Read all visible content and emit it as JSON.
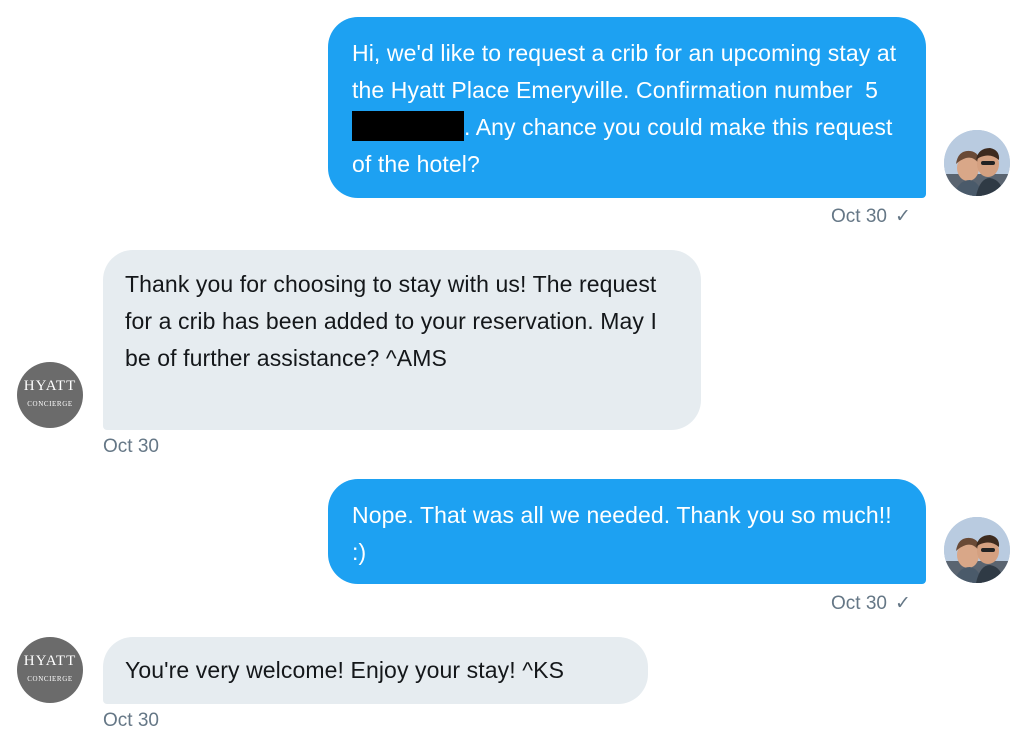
{
  "conversation": {
    "messages": [
      {
        "sender": "user",
        "text_before_redaction": "Hi, we'd like to request a crib for an upcoming stay at the Hyatt Place Emeryville. Confirmation number",
        "redaction_char": "5",
        "text_after_redaction": ". Any chance you could make this request of the hotel?",
        "time": "Oct 30",
        "read_icon": "check-icon"
      },
      {
        "sender": "hyatt",
        "text": "Thank you for choosing to stay with us! The request for a crib has been added to your reservation. May I be of further assistance? ^AMS",
        "time": "Oct 30"
      },
      {
        "sender": "user",
        "text": "Nope. That was all we needed. Thank you so much!! :)",
        "time": "Oct 30",
        "read_icon": "check-icon"
      },
      {
        "sender": "hyatt",
        "text": "You're very welcome! Enjoy your stay! ^KS",
        "time": "Oct 30"
      }
    ]
  },
  "hyatt_avatar": {
    "wordmark": "HYATT",
    "subtitle": "CONCIERGE"
  },
  "check_glyph": "✓",
  "colors": {
    "outgoing_bubble": "#1da1f2",
    "incoming_bubble": "#e6ecf0",
    "timestamp": "#657786",
    "hyatt_avatar_bg": "#6b6b6b"
  }
}
